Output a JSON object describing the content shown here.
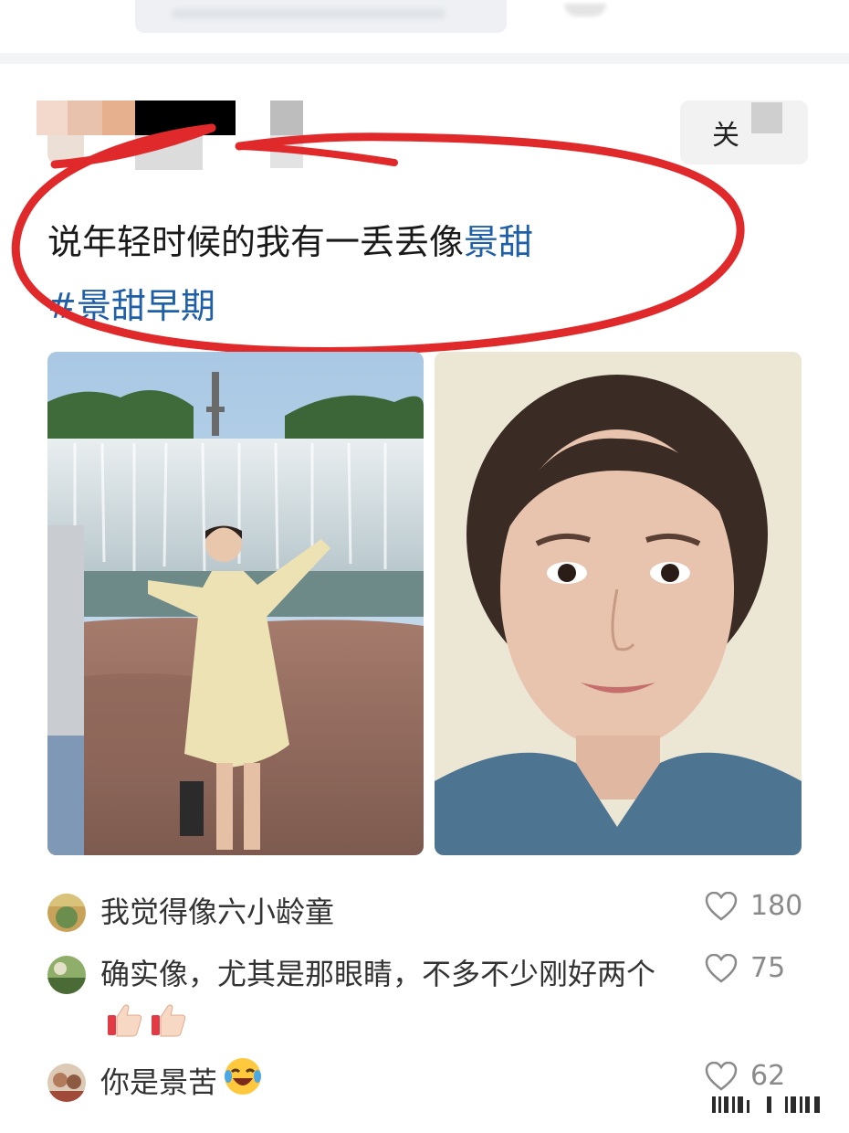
{
  "post": {
    "text": "说年轻时候的我有一丢丢像",
    "mention": "景甜",
    "hashtag": "#景甜早期"
  },
  "header": {
    "follow_label": "关"
  },
  "comments": [
    {
      "text": "我觉得像六小龄童",
      "likes": "180",
      "emoji": []
    },
    {
      "text": "确实像，尤其是那眼睛，不多不少刚好两个",
      "likes": "75",
      "emoji": [
        "thumbs-up",
        "thumbs-up"
      ]
    },
    {
      "text": "你是景苦",
      "likes": "62",
      "emoji": [
        "laughing-tears"
      ]
    }
  ],
  "colors": {
    "hashtag": "#1f5fa8",
    "annotation_circle": "#e0292b",
    "like_icon": "#8a8a8a"
  },
  "icons": [
    "heart-outline-icon",
    "thumbs-up-emoji",
    "laughing-emoji"
  ]
}
